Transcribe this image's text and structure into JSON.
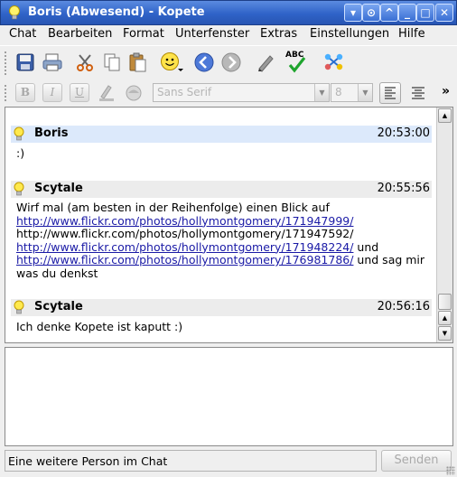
{
  "window": {
    "title": "Boris (Abwesend) - Kopete",
    "controls": [
      "menu-button",
      "sticky-button",
      "shade-button",
      "minimize-button",
      "maximize-button",
      "close-button"
    ]
  },
  "menu": {
    "items": [
      "Chat",
      "Bearbeiten",
      "Format",
      "Unterfenster",
      "Extras",
      "Einstellungen",
      "Hilfe"
    ]
  },
  "toolbar": {
    "icons": [
      "save-icon",
      "print-icon",
      "cut-icon",
      "copy-icon",
      "paste-icon",
      "smiley-icon",
      "back-icon",
      "forward-icon",
      "pen-icon",
      "spellcheck-icon",
      "contacts-icon"
    ],
    "spellcheck_label": "ABC"
  },
  "format_toolbar": {
    "bold": "B",
    "italic": "I",
    "underline": "U",
    "font_family": "Sans Serif",
    "font_size": "8",
    "overflow": "»"
  },
  "messages": [
    {
      "nick": "Boris",
      "time": "20:53:00",
      "lines": [
        ":)"
      ]
    },
    {
      "nick": "Scytale",
      "time": "20:55:56",
      "intro": "Wirf mal (am besten in der Reihenfolge) einen Blick auf",
      "link1": "http://www.flickr.com/photos/hollymontgomery/171947999/",
      "plain2": "http://www.flickr.com/photos/hollymontgomery/171947592/",
      "link3": "http://www.flickr.com/photos/hollymontgomery/171948224/",
      "after3": " und",
      "link4": "http://www.flickr.com/photos/hollymontgomery/176981786/",
      "after4": " und sag mir",
      "outro": "was du denkst"
    },
    {
      "nick": "Scytale",
      "time": "20:56:16",
      "lines": [
        "Ich denke Kopete ist kaputt :)"
      ]
    }
  ],
  "status": {
    "text": "Eine weitere Person im Chat"
  },
  "send_button": {
    "label": "Senden",
    "enabled": false
  },
  "colors": {
    "titlebar": "#2f63c8",
    "highlight_header": "#dce9fb",
    "link": "#1a1aa6"
  }
}
